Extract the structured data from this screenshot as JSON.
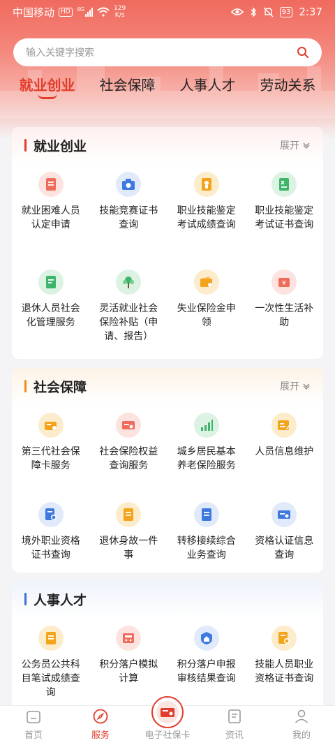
{
  "status_bar": {
    "carrier": "中国移动",
    "hd": "HD",
    "net": "4G",
    "speed_value": "129",
    "speed_unit": "K/s",
    "battery": "93",
    "time": "2:37"
  },
  "search": {
    "placeholder": "输入关键字搜索"
  },
  "tabs": [
    {
      "label": "就业创业",
      "active": true
    },
    {
      "label": "社会保障",
      "active": false
    },
    {
      "label": "人事人才",
      "active": false
    },
    {
      "label": "劳动关系",
      "active": false
    }
  ],
  "sections": {
    "employment": {
      "title": "就业创业",
      "expand": "展开",
      "items": [
        {
          "label": "就业困难人员认定申请",
          "icon": "document-icon"
        },
        {
          "label": "技能竞赛证书查询",
          "icon": "camera-icon"
        },
        {
          "label": "职业技能鉴定考试成绩查询",
          "icon": "certificate-icon"
        },
        {
          "label": "职业技能鉴定考试证书查询",
          "icon": "excel-doc-icon"
        },
        {
          "label": "退休人员社会化管理服务",
          "icon": "document-icon"
        },
        {
          "label": "灵活就业社会保险补贴（申请、报告）",
          "icon": "tree-icon"
        },
        {
          "label": "失业保险金申领",
          "icon": "wallet-icon"
        },
        {
          "label": "一次性生活补助",
          "icon": "money-icon"
        }
      ]
    },
    "social": {
      "title": "社会保障",
      "expand": "展开",
      "items": [
        {
          "label": "第三代社会保障卡服务",
          "icon": "card-wallet-icon"
        },
        {
          "label": "社会保险权益查询服务",
          "icon": "id-card-icon"
        },
        {
          "label": "城乡居民基本养老保险服务",
          "icon": "bar-chart-icon"
        },
        {
          "label": "人员信息维护",
          "icon": "profile-edit-icon"
        },
        {
          "label": "境外职业资格证书查询",
          "icon": "certificate-search-icon"
        },
        {
          "label": "退休身故一件事",
          "icon": "document-icon"
        },
        {
          "label": "转移接续综合业务查询",
          "icon": "document-icon"
        },
        {
          "label": "资格认证信息查询",
          "icon": "id-card-icon"
        }
      ]
    },
    "talent": {
      "title": "人事人才",
      "items": [
        {
          "label": "公务员公共科目笔试成绩查询",
          "icon": "document-icon"
        },
        {
          "label": "积分落户模拟计算",
          "icon": "calculator-icon"
        },
        {
          "label": "积分落户申报审核结果查询",
          "icon": "home-shield-icon"
        },
        {
          "label": "技能人员职业资格证书查询",
          "icon": "certificate-search-icon"
        }
      ]
    }
  },
  "bottom_nav": [
    {
      "label": "首页",
      "active": false
    },
    {
      "label": "服务",
      "active": true
    },
    {
      "label": "电子社保卡",
      "active": false
    },
    {
      "label": "资讯",
      "active": false
    },
    {
      "label": "我的",
      "active": false
    }
  ],
  "colors": {
    "brand_red": "#e23c2c",
    "orange": "#f08a1c",
    "blue": "#3a6fd8"
  }
}
